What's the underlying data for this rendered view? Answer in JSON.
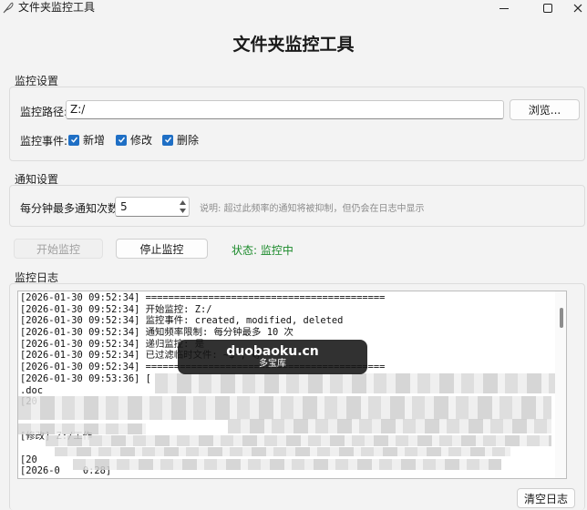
{
  "window": {
    "title": "文件夹监控工具"
  },
  "header": {
    "title": "文件夹监控工具"
  },
  "monitor_settings": {
    "section_label": "监控设置",
    "path_label": "监控路径:",
    "path_value": "Z:/",
    "browse_label": "浏览...",
    "events_label": "监控事件:",
    "events": [
      {
        "label": "新增",
        "checked": true
      },
      {
        "label": "修改",
        "checked": true
      },
      {
        "label": "删除",
        "checked": true
      }
    ]
  },
  "notify_settings": {
    "section_label": "通知设置",
    "rate_label": "每分钟最多通知次数:",
    "rate_value": "5",
    "hint": "说明: 超过此频率的通知将被抑制，但仍会在日志中显示"
  },
  "controls": {
    "start_label": "开始监控",
    "stop_label": "停止监控",
    "status_text": "状态: 监控中"
  },
  "log": {
    "section_label": "监控日志",
    "lines": [
      "[2026-01-30 09:52:34] ==========================================",
      "[2026-01-30 09:52:34] 开始监控: Z:/",
      "[2026-01-30 09:52:34] 监控事件: created, modified, deleted",
      "[2026-01-30 09:52:34] 通知频率限制: 每分钟最多 10 次",
      "[2026-01-30 09:52:34] 递归监控: 是",
      "[2026-01-30 09:52:34] 已过滤临时文件: ~$*, 等",
      "[2026-01-30 09:52:34] ==========================================",
      "[2026-01-30 09:53:36] [",
      ".doc",
      "[20",
      "",
      "",
      "[修改] Z:/工作",
      "",
      "[20",
      "[2026-0    0:28]",
      "",
      "公司"
    ],
    "clear_label": "清空日志"
  },
  "watermark": {
    "main": "duobaoku.cn",
    "sub": "多宝库"
  },
  "colors": {
    "accent": "#1f6fc5",
    "status_green": "#1a8a2a"
  }
}
